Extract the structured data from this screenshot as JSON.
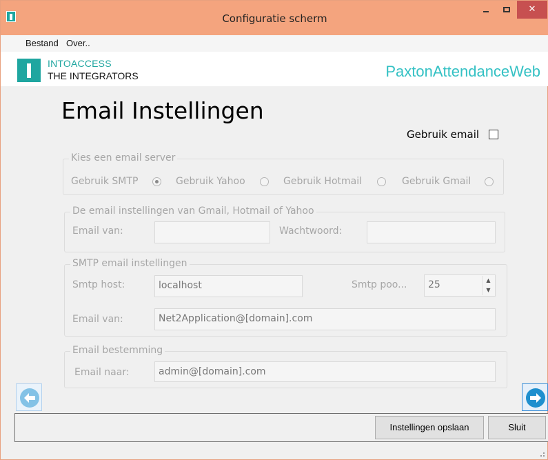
{
  "window": {
    "title": "Configuratie scherm",
    "minimize_glyph": "–",
    "maximize_glyph": "□",
    "close_glyph": "✕"
  },
  "menu": {
    "items": [
      {
        "label": "Bestand"
      },
      {
        "label": "Over.."
      }
    ]
  },
  "header": {
    "logo_line1": "INTOACCESS",
    "logo_line2": "THE INTEGRATORS",
    "product_name": "PaxtonAttendanceWeb",
    "accent_color": "#1fa6a0"
  },
  "page": {
    "title": "Email Instellingen",
    "use_email_label": "Gebruik email",
    "use_email_checked": false
  },
  "server_group": {
    "legend": "Kies een email server",
    "options": [
      {
        "label": "Gebruik SMTP",
        "selected": true
      },
      {
        "label": "Gebruik Yahoo",
        "selected": false
      },
      {
        "label": "Gebruik Hotmail",
        "selected": false
      },
      {
        "label": "Gebruik Gmail",
        "selected": false
      }
    ]
  },
  "provider_group": {
    "legend": "De email instellingen van Gmail, Hotmail of Yahoo",
    "email_from_label": "Email van:",
    "email_from_value": "",
    "password_label": "Wachtwoord:",
    "password_value": ""
  },
  "smtp_group": {
    "legend": "SMTP email instellingen",
    "host_label": "Smtp host:",
    "host_value": "localhost",
    "port_label": "Smtp poo...",
    "port_value": "25",
    "email_from_label": "Email van:",
    "email_from_value": "Net2Application@[domain].com"
  },
  "destination_group": {
    "legend": "Email bestemming",
    "email_to_label": "Email naar:",
    "email_to_value": "admin@[domain].com"
  },
  "footer": {
    "save_label": "Instellingen opslaan",
    "close_label": "Sluit"
  }
}
